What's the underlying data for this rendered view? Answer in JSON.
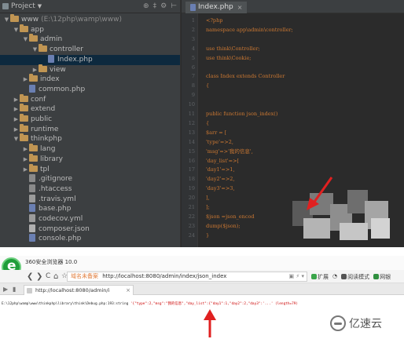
{
  "ide": {
    "project_panel": {
      "label": "Project",
      "tool_icons": [
        "⊕",
        "‡",
        "⚙",
        "⊢"
      ]
    },
    "tree": [
      {
        "indent": 0,
        "arrow": "▼",
        "icon": "folder",
        "label": "www",
        "suffix": "(E:\\12php\\wamp\\www)"
      },
      {
        "indent": 1,
        "arrow": "▼",
        "icon": "folder",
        "label": "app"
      },
      {
        "indent": 2,
        "arrow": "▼",
        "icon": "folder",
        "label": "admin"
      },
      {
        "indent": 3,
        "arrow": "▼",
        "icon": "folder",
        "label": "controller"
      },
      {
        "indent": 4,
        "arrow": "",
        "icon": "php",
        "label": "Index.php",
        "selected": true
      },
      {
        "indent": 3,
        "arrow": "▶",
        "icon": "folder",
        "label": "view"
      },
      {
        "indent": 2,
        "arrow": "▶",
        "icon": "folder",
        "label": "index"
      },
      {
        "indent": 2,
        "arrow": "",
        "icon": "php",
        "label": "common.php"
      },
      {
        "indent": 1,
        "arrow": "▶",
        "icon": "folder",
        "label": "conf"
      },
      {
        "indent": 1,
        "arrow": "▶",
        "icon": "folder",
        "label": "extend"
      },
      {
        "indent": 1,
        "arrow": "▶",
        "icon": "folder",
        "label": "public"
      },
      {
        "indent": 1,
        "arrow": "▶",
        "icon": "folder",
        "label": "runtime"
      },
      {
        "indent": 1,
        "arrow": "▼",
        "icon": "folder",
        "label": "thinkphp"
      },
      {
        "indent": 2,
        "arrow": "▶",
        "icon": "folder",
        "label": "lang"
      },
      {
        "indent": 2,
        "arrow": "▶",
        "icon": "folder",
        "label": "library"
      },
      {
        "indent": 2,
        "arrow": "▶",
        "icon": "folder",
        "label": "tpl"
      },
      {
        "indent": 2,
        "arrow": "",
        "icon": "file",
        "label": ".gitignore"
      },
      {
        "indent": 2,
        "arrow": "",
        "icon": "file",
        "label": ".htaccess"
      },
      {
        "indent": 2,
        "arrow": "",
        "icon": "yml",
        "label": ".travis.yml"
      },
      {
        "indent": 2,
        "arrow": "",
        "icon": "php",
        "label": "base.php"
      },
      {
        "indent": 2,
        "arrow": "",
        "icon": "yml",
        "label": "codecov.yml"
      },
      {
        "indent": 2,
        "arrow": "",
        "icon": "json",
        "label": "composer.json"
      },
      {
        "indent": 2,
        "arrow": "",
        "icon": "php",
        "label": "console.php"
      }
    ],
    "editor": {
      "tab_label": "Index.php",
      "lines": [
        {
          "n": "1",
          "code": "<?php"
        },
        {
          "n": "2",
          "code": "    namespace app\\admin\\controller;"
        },
        {
          "n": "3",
          "code": ""
        },
        {
          "n": "4",
          "code": "    use think\\Controller;"
        },
        {
          "n": "5",
          "code": "    use think\\Cookie;"
        },
        {
          "n": "6",
          "code": ""
        },
        {
          "n": "7",
          "code": "    class Index extends Controller"
        },
        {
          "n": "8",
          "code": "    {"
        },
        {
          "n": "9",
          "code": ""
        },
        {
          "n": "10",
          "code": ""
        },
        {
          "n": "11",
          "code": "        public function json_index()"
        },
        {
          "n": "12",
          "code": "        {"
        },
        {
          "n": "13",
          "code": "            $arr = ["
        },
        {
          "n": "14",
          "code": "                'type'=>2,"
        },
        {
          "n": "15",
          "code": "                'msg'=>'我的信息',"
        },
        {
          "n": "16",
          "code": "                'day_list'=>["
        },
        {
          "n": "17",
          "code": "                    'day1'=>1,"
        },
        {
          "n": "18",
          "code": "                    'day2'=>2,"
        },
        {
          "n": "19",
          "code": "                    'day3'=>3,"
        },
        {
          "n": "20",
          "code": "                ],"
        },
        {
          "n": "21",
          "code": "            ];"
        },
        {
          "n": "22",
          "code": "            $json =json_encod"
        },
        {
          "n": "23",
          "code": "            dump($json);"
        },
        {
          "n": "24",
          "code": "        }"
        }
      ]
    }
  },
  "browser": {
    "title": "360安全浏览器 10.0",
    "nav": {
      "back": "❮",
      "forward": "❯",
      "refresh": "C",
      "home": "⌂",
      "favorite": "☆"
    },
    "address": {
      "secure_label": "域名未备案",
      "url": "http://localhost:8080/admin/index/json_index"
    },
    "right_items": {
      "expand": "扩展",
      "reading": "阅读模式",
      "net": "网银"
    },
    "tab": {
      "label": "http://localhost:8080/admin/i",
      "close": "×"
    },
    "output": {
      "path": "E:\\12php\\wamp\\www\\thinkphp\\library\\think\\Debug.php:193:string",
      "json": "'{\"type\":2,\"msg\":\"我的信息\",\"day_list\":{\"day1\":1,\"day2\":2,\"day3\":'...' (length=79)"
    }
  },
  "watermark": "亿速云",
  "colors": {
    "arrow_red": "#e02020",
    "selection": "#0d293e",
    "keyword": "#cc7832"
  }
}
